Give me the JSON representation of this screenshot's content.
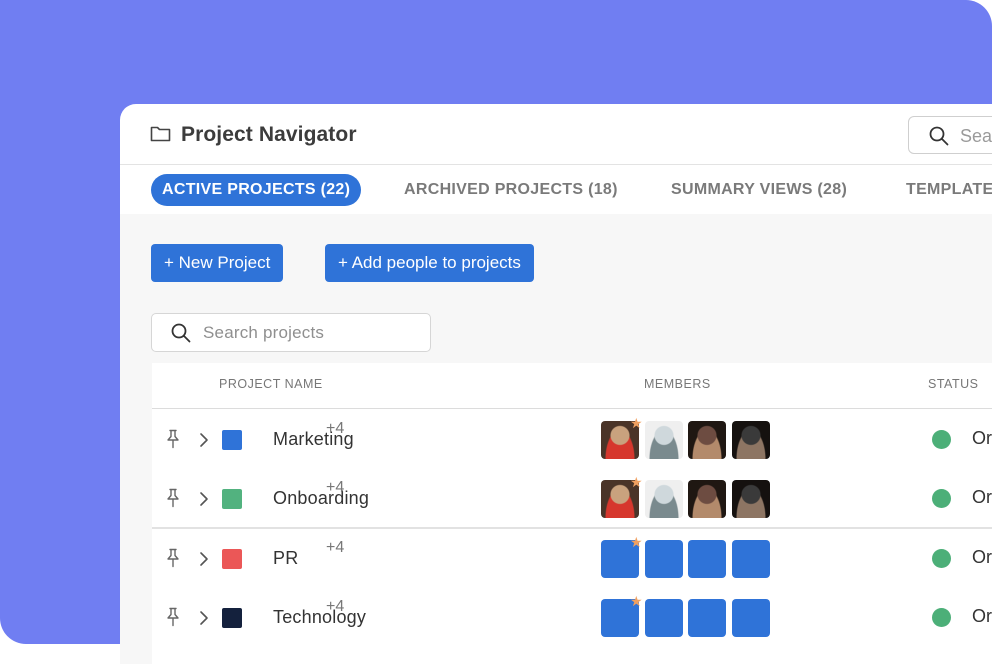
{
  "app": {
    "title": "Project Navigator",
    "search_placeholder": "Sea"
  },
  "tabs": [
    {
      "label": "ACTIVE PROJECTS (22)",
      "active": true
    },
    {
      "label": "ARCHIVED PROJECTS (18)",
      "active": false
    },
    {
      "label": "SUMMARY VIEWS (28)",
      "active": false
    },
    {
      "label": "TEMPLATE",
      "active": false
    }
  ],
  "actions": {
    "new_project": "+ New Project",
    "add_people": "+ Add people to projects"
  },
  "project_search": {
    "placeholder": "Search projects"
  },
  "table": {
    "headers": {
      "name": "PROJECT NAME",
      "members": "MEMBERS",
      "status": "STATUS"
    },
    "rows": [
      {
        "name": "Marketing",
        "color": "#2f73d8",
        "members_more": "+4",
        "status": "Or",
        "status_color": "#4caf78",
        "avatars": "photos"
      },
      {
        "name": "Onboarding",
        "color": "#52b27f",
        "members_more": "+4",
        "status": "Or",
        "status_color": "#4caf78",
        "avatars": "photos"
      },
      {
        "name": "PR",
        "color": "#eb5757",
        "members_more": "+4",
        "status": "Or",
        "status_color": "#4caf78",
        "avatars": "blue"
      },
      {
        "name": "Technology",
        "color": "#14213d",
        "members_more": "+4",
        "status": "Or",
        "status_color": "#4caf78",
        "avatars": "blue"
      }
    ]
  },
  "colors": {
    "background": "#707ef2",
    "accent": "#2f73d8",
    "status_green": "#4caf78",
    "owner_star": "#f0a060"
  },
  "icons": [
    "folder-icon",
    "search-icon",
    "pin-icon",
    "chevron-right-icon",
    "star-icon"
  ]
}
